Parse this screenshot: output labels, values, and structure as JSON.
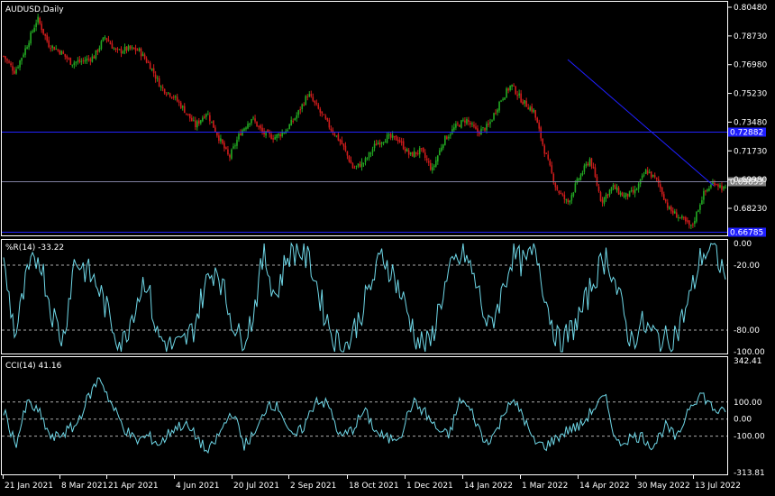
{
  "main": {
    "symbol_label": "AUDUSD,Daily",
    "price_ticks": [
      "0.80480",
      "0.78730",
      "0.76980",
      "0.75230",
      "0.73480",
      "0.71730",
      "0.69980",
      "0.68230"
    ],
    "price_tick_values": [
      0.8048,
      0.7873,
      0.6998,
      0.7523,
      0.7348,
      0.7173,
      0.6998,
      0.6823
    ],
    "hlines": [
      {
        "label": "0.72882",
        "value": 0.72882,
        "color": "#2222ff",
        "label_bg": "#1f1fff"
      },
      {
        "label": "0.69853",
        "value": 0.69853,
        "color": "#8080a0",
        "label_bg": "#808080"
      },
      {
        "label": "0.66785",
        "value": 0.66785,
        "color": "#2222ff",
        "label_bg": "#1f1fff"
      }
    ],
    "bull_color": "#22a822",
    "bear_color": "#d01c1c",
    "trendline_color": "#1f1fff"
  },
  "wpr": {
    "label": "%R(14) -33.22",
    "ticks": [
      "0.00",
      "-20.00",
      "-80.00",
      "-100.00"
    ],
    "tick_values": [
      0,
      -20,
      -80,
      -100
    ],
    "levels": [
      -20,
      -80
    ],
    "color": "#6fd8e8"
  },
  "cci": {
    "label": "CCI(14) 41.16",
    "ticks": [
      "342.41",
      "100.00",
      "0.00",
      "-100.00",
      "-313.81"
    ],
    "tick_values": [
      342.41,
      100,
      0,
      -100,
      -313.81
    ],
    "levels": [
      100,
      0,
      -100
    ],
    "color": "#6fd8e8"
  },
  "date_axis": [
    "21 Jan 2021",
    "8 Mar 2021",
    "21 Apr 2021",
    "4 Jun 2021",
    "20 Jul 2021",
    "2 Sep 2021",
    "18 Oct 2021",
    "1 Dec 2021",
    "14 Jan 2022",
    "1 Mar 2022",
    "14 Apr 2022",
    "30 May 2022",
    "13 Jul 2022"
  ],
  "chart_data": {
    "type": "candlestick",
    "price_anchors": [
      0.775,
      0.7655,
      0.7805,
      0.798,
      0.782,
      0.778,
      0.771,
      0.772,
      0.7745,
      0.787,
      0.7775,
      0.7795,
      0.7785,
      0.769,
      0.7555,
      0.751,
      0.7425,
      0.7325,
      0.741,
      0.7265,
      0.713,
      0.7285,
      0.7375,
      0.728,
      0.7255,
      0.7295,
      0.739,
      0.752,
      0.7415,
      0.731,
      0.7215,
      0.7065,
      0.7105,
      0.7215,
      0.7255,
      0.7245,
      0.7145,
      0.7175,
      0.7055,
      0.7235,
      0.7315,
      0.7365,
      0.7285,
      0.7325,
      0.7475,
      0.7575,
      0.7475,
      0.7415,
      0.7165,
      0.6945,
      0.6855,
      0.7005,
      0.7125,
      0.6865,
      0.6955,
      0.6895,
      0.6925,
      0.7055,
      0.6985,
      0.6815,
      0.6765,
      0.6705,
      0.6905,
      0.6985,
      0.6935
    ],
    "wpr_anchors": [
      -20,
      -85,
      -30,
      -10,
      -60,
      -90,
      -15,
      -25,
      -40,
      -70,
      -95,
      -60,
      -30,
      -85,
      -95,
      -95,
      -80,
      -40,
      -20,
      -60,
      -90,
      -70,
      -10,
      -50,
      -10,
      -5,
      -20,
      -60,
      -90,
      -95,
      -70,
      -40,
      -10,
      -30,
      -60,
      -90,
      -95,
      -50,
      -20,
      -10,
      -40,
      -80,
      -50,
      -10,
      -20,
      -5,
      -60,
      -95,
      -80,
      -60,
      -30,
      -10,
      -50,
      -90,
      -75,
      -85,
      -90,
      -80,
      -50,
      -10,
      -5,
      -30
    ],
    "cci_anchors": [
      50,
      -150,
      100,
      30,
      -120,
      -80,
      -40,
      120,
      250,
      80,
      -50,
      -130,
      -100,
      -150,
      -60,
      -30,
      -100,
      -200,
      -80,
      50,
      -150,
      -80,
      100,
      60,
      -120,
      -40,
      120,
      80,
      -110,
      -60,
      50,
      -80,
      -120,
      -90,
      100,
      40,
      -60,
      -100,
      120,
      30,
      -140,
      -70,
      110,
      50,
      -130,
      -160,
      -110,
      -60,
      -40,
      60,
      130,
      -150,
      -110,
      -100,
      -160,
      -40,
      -120,
      80,
      150,
      60,
      30
    ],
    "wpr_last": -33.22,
    "cci_last": 41.16
  }
}
